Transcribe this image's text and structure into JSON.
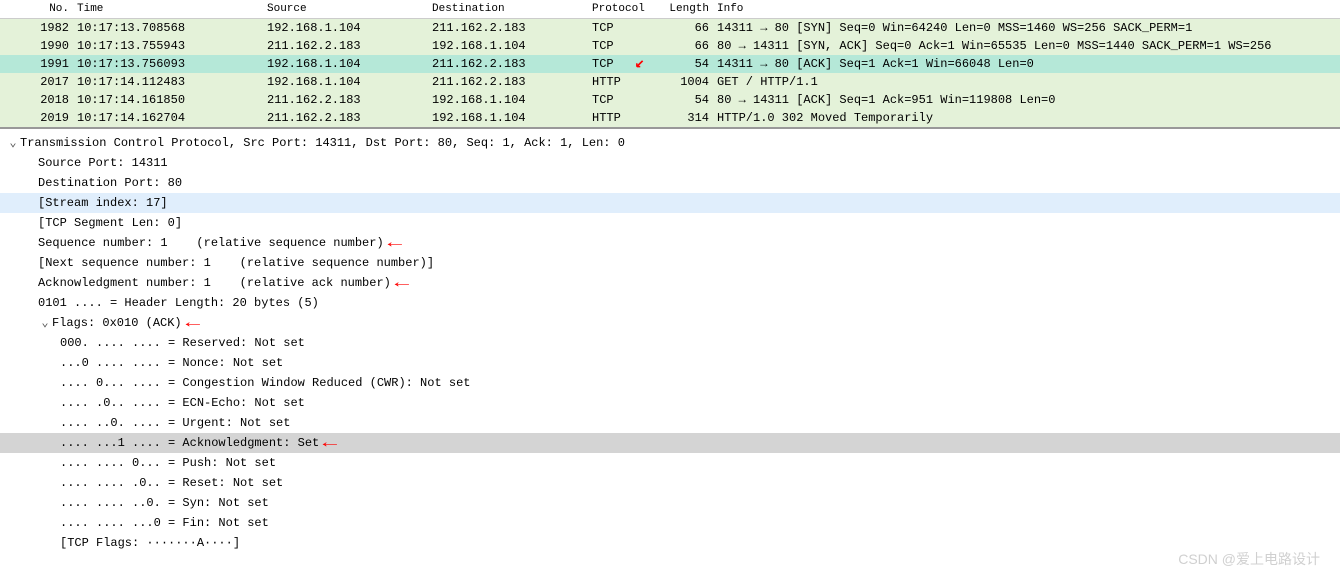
{
  "headers": {
    "no": "No.",
    "time": "Time",
    "source": "Source",
    "destination": "Destination",
    "protocol": "Protocol",
    "length": "Length",
    "info": "Info"
  },
  "packets": [
    {
      "no": "1982",
      "time": "10:17:13.708568",
      "src": "192.168.1.104",
      "dst": "211.162.2.183",
      "proto": "TCP",
      "len": "66",
      "info": "14311 → 80 [SYN] Seq=0 Win=64240 Len=0 MSS=1460 WS=256 SACK_PERM=1",
      "cls": "bg-light-green"
    },
    {
      "no": "1990",
      "time": "10:17:13.755943",
      "src": "211.162.2.183",
      "dst": "192.168.1.104",
      "proto": "TCP",
      "len": "66",
      "info": "80 → 14311 [SYN, ACK] Seq=0 Ack=1 Win=65535 Len=0 MSS=1440 SACK_PERM=1 WS=256",
      "cls": "bg-light-green"
    },
    {
      "no": "1991",
      "time": "10:17:13.756093",
      "src": "192.168.1.104",
      "dst": "211.162.2.183",
      "proto": "TCP",
      "len": "54",
      "info": "14311 → 80 [ACK] Seq=1 Ack=1 Win=66048 Len=0",
      "cls": "bg-selected",
      "arrow": true
    },
    {
      "no": "2017",
      "time": "10:17:14.112483",
      "src": "192.168.1.104",
      "dst": "211.162.2.183",
      "proto": "HTTP",
      "len": "1004",
      "info": "GET / HTTP/1.1",
      "cls": "bg-light-green"
    },
    {
      "no": "2018",
      "time": "10:17:14.161850",
      "src": "211.162.2.183",
      "dst": "192.168.1.104",
      "proto": "TCP",
      "len": "54",
      "info": "80 → 14311 [ACK] Seq=1 Ack=951 Win=119808 Len=0",
      "cls": "bg-light-green"
    },
    {
      "no": "2019",
      "time": "10:17:14.162704",
      "src": "211.162.2.183",
      "dst": "192.168.1.104",
      "proto": "HTTP",
      "len": "314",
      "info": "HTTP/1.0 302 Moved Temporarily",
      "cls": "bg-light-green"
    }
  ],
  "details": [
    {
      "lvl": 0,
      "exp": "v",
      "text": "Transmission Control Protocol, Src Port: 14311, Dst Port: 80, Seq: 1, Ack: 1, Len: 0"
    },
    {
      "lvl": 1,
      "text": "Source Port: 14311"
    },
    {
      "lvl": 1,
      "text": "Destination Port: 80"
    },
    {
      "lvl": 1,
      "text": "[Stream index: 17]",
      "hl": "blue"
    },
    {
      "lvl": 1,
      "text": "[TCP Segment Len: 0]"
    },
    {
      "lvl": 1,
      "text": "Sequence number: 1    (relative sequence number)",
      "arrow": true
    },
    {
      "lvl": 1,
      "text": "[Next sequence number: 1    (relative sequence number)]"
    },
    {
      "lvl": 1,
      "text": "Acknowledgment number: 1    (relative ack number)",
      "arrow": true
    },
    {
      "lvl": 1,
      "text": "0101 .... = Header Length: 20 bytes (5)"
    },
    {
      "lvl": 1,
      "exp": "v",
      "text": "Flags: 0x010 (ACK)",
      "arrow": true
    },
    {
      "lvl": 2,
      "text": "000. .... .... = Reserved: Not set"
    },
    {
      "lvl": 2,
      "text": "...0 .... .... = Nonce: Not set"
    },
    {
      "lvl": 2,
      "text": ".... 0... .... = Congestion Window Reduced (CWR): Not set"
    },
    {
      "lvl": 2,
      "text": ".... .0.. .... = ECN-Echo: Not set"
    },
    {
      "lvl": 2,
      "text": ".... ..0. .... = Urgent: Not set"
    },
    {
      "lvl": 2,
      "text": ".... ...1 .... = Acknowledgment: Set",
      "hl": "grey",
      "arrow": true
    },
    {
      "lvl": 2,
      "text": ".... .... 0... = Push: Not set"
    },
    {
      "lvl": 2,
      "text": ".... .... .0.. = Reset: Not set"
    },
    {
      "lvl": 2,
      "text": ".... .... ..0. = Syn: Not set"
    },
    {
      "lvl": 2,
      "text": ".... .... ...0 = Fin: Not set"
    },
    {
      "lvl": 2,
      "text": "[TCP Flags: ·······A····]"
    }
  ],
  "watermark": "CSDN @爱上电路设计"
}
